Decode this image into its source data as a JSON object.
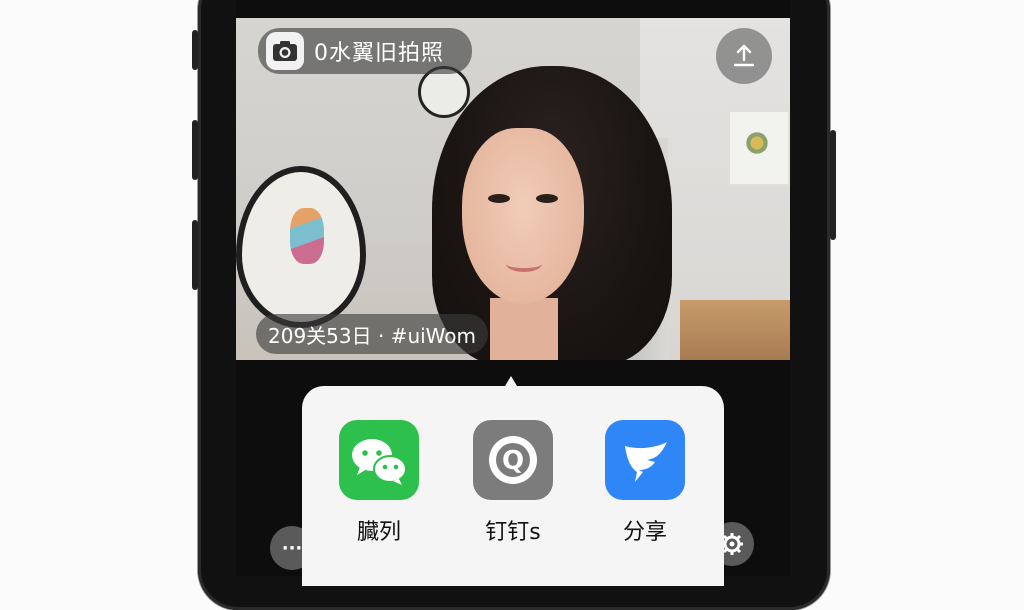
{
  "camera": {
    "watermark_label": "0水翼旧拍照",
    "date_label": "209关53日 · #uiWom"
  },
  "share_sheet": {
    "apps": [
      {
        "label": "臓列",
        "icon": "wechat-icon",
        "color": "#2dc04d"
      },
      {
        "label": "钉钉s",
        "icon": "qq-icon",
        "color": "#7c7c7c"
      },
      {
        "label": "分享",
        "icon": "dingtalk-icon",
        "color": "#2f86f6"
      }
    ]
  },
  "controls": {
    "more_glyph": "···"
  }
}
